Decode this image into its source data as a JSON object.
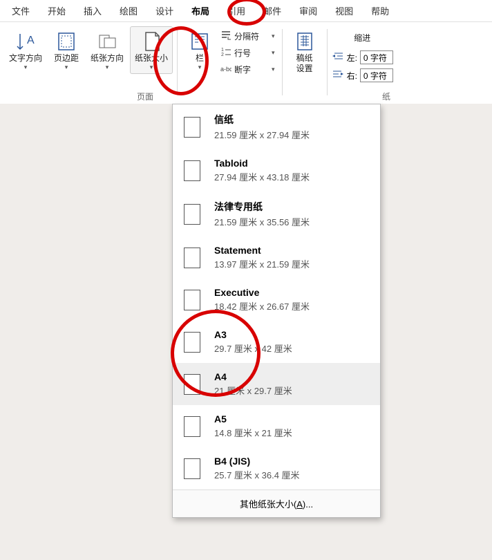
{
  "menu": [
    "文件",
    "开始",
    "插入",
    "绘图",
    "设计",
    "布局",
    "引用",
    "邮件",
    "审阅",
    "视图",
    "帮助"
  ],
  "menu_active": 5,
  "ribbon": {
    "text_direction": "文字方向",
    "margins": "页边距",
    "orientation": "纸张方向",
    "size": "纸张大小",
    "columns": "栏",
    "breaks": "分隔符",
    "line_numbers": "行号",
    "hyphenation": "断字",
    "manuscript": "稿纸\n设置",
    "group_page_setup": "页面",
    "group_paper": "纸",
    "indent": {
      "header": "缩进",
      "left_label": "左:",
      "left_value": "0 字符",
      "right_label": "右:",
      "right_value": "0 字符"
    }
  },
  "dropdown": {
    "items": [
      {
        "name": "信纸",
        "dims": "21.59 厘米 x 27.94 厘米"
      },
      {
        "name": "Tabloid",
        "dims": "27.94 厘米 x 43.18 厘米"
      },
      {
        "name": "法律专用纸",
        "dims": "21.59 厘米 x 35.56 厘米"
      },
      {
        "name": "Statement",
        "dims": "13.97 厘米 x 21.59 厘米"
      },
      {
        "name": "Executive",
        "dims": "18.42 厘米 x 26.67 厘米"
      },
      {
        "name": "A3",
        "dims": "29.7 厘米 x 42 厘米"
      },
      {
        "name": "A4",
        "dims": "21 厘米 x 29.7 厘米",
        "selected": true
      },
      {
        "name": "A5",
        "dims": "14.8 厘米 x 21 厘米"
      },
      {
        "name": "B4 (JIS)",
        "dims": "25.7 厘米 x 36.4 厘米"
      }
    ],
    "footer_pre": "其他纸张大小(",
    "footer_u": "A",
    "footer_post": ")..."
  }
}
